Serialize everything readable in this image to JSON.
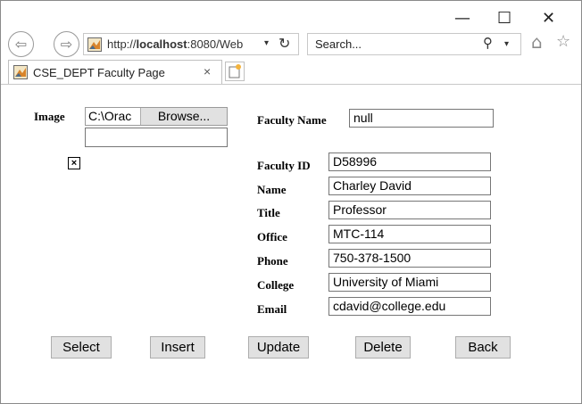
{
  "window": {
    "minimize_glyph": "—",
    "maximize_glyph": "☐",
    "close_glyph": "✕"
  },
  "nav": {
    "back_glyph": "⇦",
    "forward_glyph": "⇨",
    "url_prefix": "http://",
    "url_host": "localhost",
    "url_rest": ":8080/Web",
    "address_dropdown_glyph": "▾",
    "refresh_glyph": "↻",
    "search_placeholder": "Search...",
    "search_icon_glyph": "⚲",
    "search_dropdown_glyph": "▾",
    "home_glyph": "⌂",
    "favorites_glyph": "☆"
  },
  "tab": {
    "title": "CSE_DEPT Faculty Page",
    "close_glyph": "×"
  },
  "form": {
    "image_label": "Image",
    "image_path": "C:\\Orac",
    "browse_label": "Browse...",
    "broken_image_glyph": "×",
    "faculty_name_label": "Faculty Name",
    "faculty_name_value": "null",
    "fields": [
      {
        "label": "Faculty ID",
        "value": "D58996"
      },
      {
        "label": "Name",
        "value": "Charley David"
      },
      {
        "label": "Title",
        "value": "Professor"
      },
      {
        "label": "Office",
        "value": "MTC-114"
      },
      {
        "label": "Phone",
        "value": "750-378-1500"
      },
      {
        "label": "College",
        "value": "University of Miami"
      },
      {
        "label": "Email",
        "value": "cdavid@college.edu"
      }
    ]
  },
  "buttons": {
    "select": "Select",
    "insert": "Insert",
    "update": "Update",
    "delete": "Delete",
    "back": "Back"
  },
  "colors": {
    "button_bg": "#e1e1e1",
    "border": "#767676"
  }
}
